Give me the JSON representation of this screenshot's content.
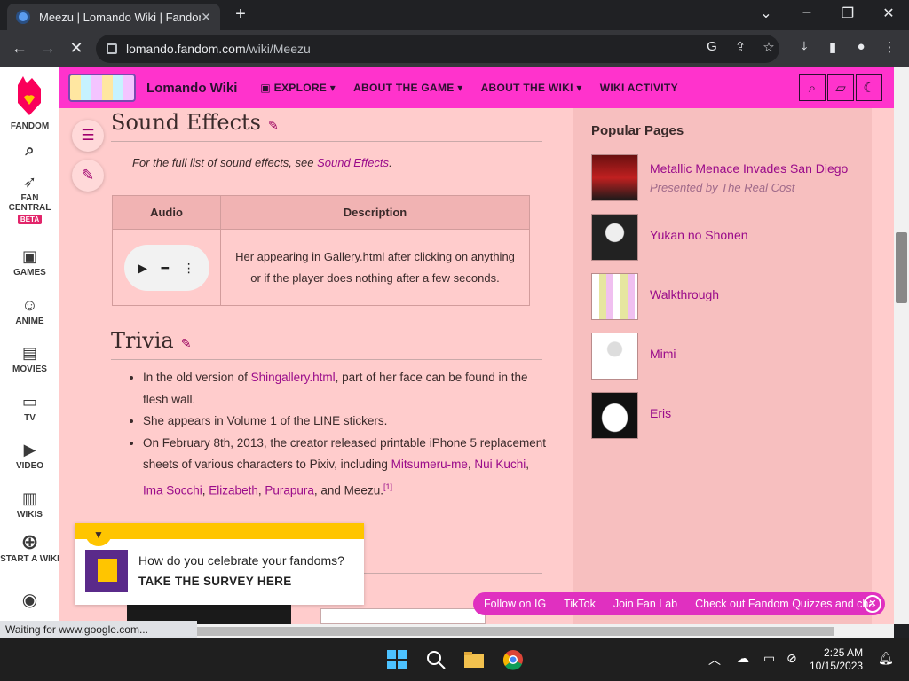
{
  "browser": {
    "tab_title": "Meezu | Lomando Wiki | Fandom",
    "url_host": "lomando.fandom.com",
    "url_path": "/wiki/Meezu",
    "status_text": "Waiting for www.google.com..."
  },
  "rail": {
    "items": [
      {
        "label": "FANDOM",
        "icon": "fandom-logo"
      },
      {
        "label": "",
        "icon": "search-icon"
      },
      {
        "label": "FAN CENTRAL",
        "badge": "BETA",
        "icon": "rocket-icon"
      },
      {
        "label": "GAMES",
        "icon": "gamepad-icon"
      },
      {
        "label": "ANIME",
        "icon": "anime-icon"
      },
      {
        "label": "MOVIES",
        "icon": "movie-icon"
      },
      {
        "label": "TV",
        "icon": "tv-icon"
      },
      {
        "label": "VIDEO",
        "icon": "video-icon"
      },
      {
        "label": "WIKIS",
        "icon": "wikis-icon"
      },
      {
        "label": "START A WIKI",
        "icon": "plus-icon"
      }
    ]
  },
  "wiki": {
    "name": "Lomando Wiki",
    "menu": [
      "EXPLORE",
      "ABOUT THE GAME",
      "ABOUT THE WIKI",
      "WIKI ACTIVITY"
    ]
  },
  "article": {
    "sound_effects_title": "Sound Effects",
    "note_prefix": "For the full list of sound effects, see ",
    "note_link": "Sound Effects",
    "note_suffix": ".",
    "table": {
      "headers": [
        "Audio",
        "Description"
      ],
      "description": "Her appearing in Gallery.html after clicking on anything or if the player does nothing after a few seconds."
    },
    "trivia_title": "Trivia",
    "trivia": [
      {
        "pre": "In the old version of ",
        "link": "Shingallery.html",
        "post": ", part of her face can be found in the flesh wall."
      },
      {
        "pre": "She appears in Volume 1 of the LINE stickers.",
        "link": "",
        "post": ""
      },
      {
        "pre": "On February 8th, 2013, the creator released printable iPhone 5 replacement sheets of various characters to Pixiv, including ",
        "links": [
          "Mitsumeru-me",
          "Nui Kuchi",
          "Ima Socchi",
          "Elizabeth",
          "Purapura"
        ],
        "post": ", and Meezu.",
        "ref": "[1]"
      }
    ]
  },
  "popular": {
    "title": "Popular Pages",
    "items": [
      {
        "title": "Metallic Menace Invades San Diego",
        "subtitle": "Presented by The Real Cost"
      },
      {
        "title": "Yukan no Shonen",
        "subtitle": ""
      },
      {
        "title": "Walkthrough",
        "subtitle": ""
      },
      {
        "title": "Mimi",
        "subtitle": ""
      },
      {
        "title": "Eris",
        "subtitle": ""
      }
    ]
  },
  "survey": {
    "question": "How do you celebrate your fandoms?",
    "cta": "TAKE THE SURVEY HERE"
  },
  "fanbar": {
    "items": [
      "Follow on IG",
      "TikTok",
      "Join Fan Lab",
      "Check out Fandom Quizzes and cha"
    ]
  },
  "taskbar": {
    "time": "2:25 AM",
    "date": "10/15/2023"
  },
  "colors": {
    "wiki_header": "#ff33cc",
    "content_bg": "#ffcccc",
    "link": "#9a0b8a"
  }
}
